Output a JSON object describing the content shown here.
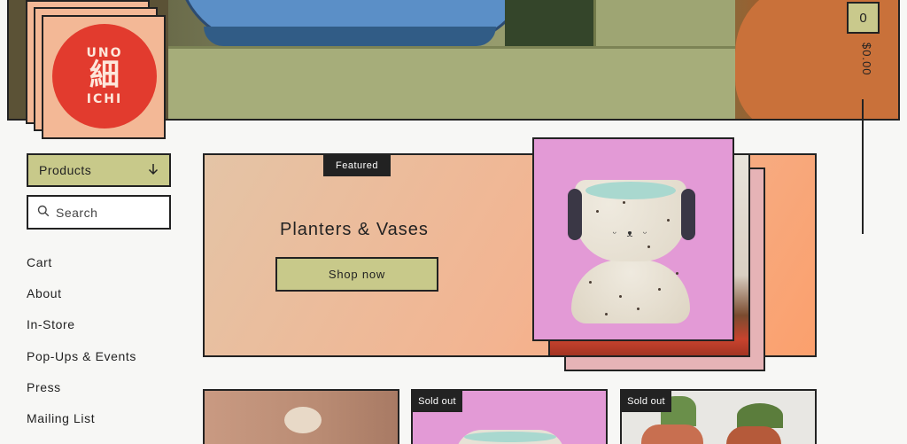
{
  "logo": {
    "line1": "UNO",
    "line2": "細",
    "line3": "ICHI"
  },
  "cart": {
    "count": "0",
    "total": "$0.00"
  },
  "sidebar": {
    "products_label": "Products",
    "search_placeholder": "Search",
    "nav": [
      {
        "label": "Cart"
      },
      {
        "label": "About"
      },
      {
        "label": "In-Store"
      },
      {
        "label": "Pop-Ups & Events"
      },
      {
        "label": "Press"
      },
      {
        "label": "Mailing List"
      }
    ]
  },
  "featured": {
    "tag": "Featured",
    "title": "Planters & Vases",
    "button": "Shop now"
  },
  "products": [
    {
      "tag": ""
    },
    {
      "tag": "Sold out"
    },
    {
      "tag": "Sold out"
    }
  ],
  "colors": {
    "accent": "#c8c98a",
    "logo_red": "#e23b2e",
    "logo_peach": "#f3b896",
    "feature_pink": "#e39ad6",
    "dark": "#222222"
  }
}
